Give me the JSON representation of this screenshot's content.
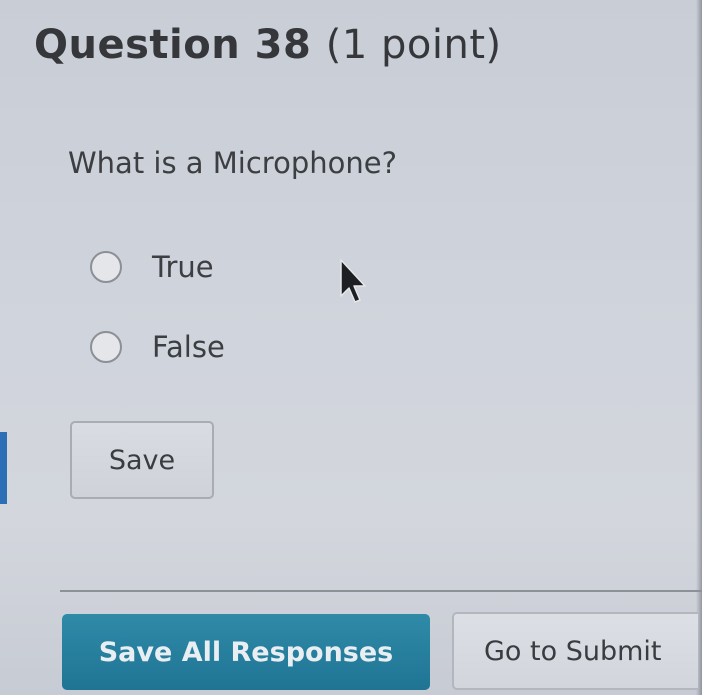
{
  "question": {
    "title": "Question 38",
    "points": "(1 point)",
    "text": "What is a Microphone?"
  },
  "options": [
    {
      "label": "True",
      "selected": false
    },
    {
      "label": "False",
      "selected": false
    }
  ],
  "buttons": {
    "save_label": "Save",
    "save_all_label": "Save All Responses",
    "submit_label": "Go to Submit"
  },
  "colors": {
    "primary_button": "#1f7494",
    "accent_bar": "#2c6fb5"
  },
  "icons": {
    "cursor": "mouse-pointer-icon"
  }
}
